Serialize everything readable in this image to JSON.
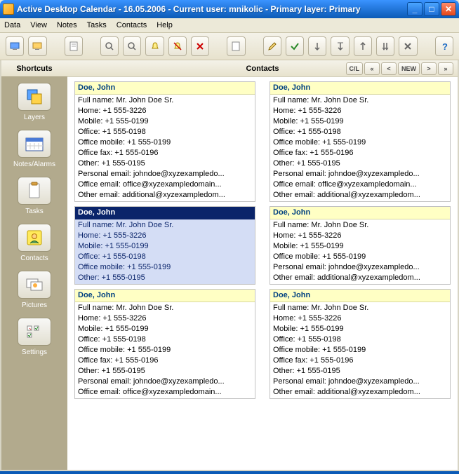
{
  "window": {
    "title": "Active Desktop Calendar - 16.05.2006 - Current user: mnikolic - Primary layer: Primary"
  },
  "menu": {
    "items": [
      "Data",
      "View",
      "Notes",
      "Tasks",
      "Contacts",
      "Help"
    ]
  },
  "sidebar": {
    "header": "Shortcuts",
    "items": [
      {
        "id": "layers",
        "label": "Layers"
      },
      {
        "id": "notes-alarms",
        "label": "Notes/Alarms"
      },
      {
        "id": "tasks",
        "label": "Tasks"
      },
      {
        "id": "contacts",
        "label": "Contacts"
      },
      {
        "id": "pictures",
        "label": "Pictures"
      },
      {
        "id": "settings",
        "label": "Settings"
      }
    ]
  },
  "main": {
    "title": "Contacts",
    "nav": {
      "cl": "C/L",
      "prev2": "«",
      "prev": "<",
      "new": "NEW",
      "next": ">",
      "next2": "»"
    }
  },
  "contacts": [
    {
      "name": "Doe, John",
      "selected": false,
      "rows": [
        "Full name: Mr. John Doe  Sr.",
        "Home:  +1 555-3226",
        "Mobile:  +1 555-0199",
        "Office:  +1 555-0198",
        "Office mobile:  +1 555-0199",
        "Office fax:  +1 555-0196",
        "Other:  +1 555-0195",
        "Personal email: johndoe@xyzexampledo...",
        "Office email: office@xyzexampledomain...",
        "Other email: additional@xyzexampledom..."
      ]
    },
    {
      "name": "Doe, John",
      "selected": false,
      "rows": [
        "Full name: Mr. John Doe  Sr.",
        "Home:  +1 555-3226",
        "Mobile:  +1 555-0199",
        "Office:  +1 555-0198",
        "Office mobile:  +1 555-0199",
        "Office fax:  +1 555-0196",
        "Other:  +1 555-0195",
        "Personal email: johndoe@xyzexampledo...",
        "Office email: office@xyzexampledomain...",
        "Other email: additional@xyzexampledom..."
      ]
    },
    {
      "name": "Doe, John",
      "selected": true,
      "rows": [
        "Full name: Mr. John Doe  Sr.",
        "Home:  +1 555-3226",
        "Mobile:  +1 555-0199",
        "Office:  +1 555-0198",
        "Office mobile:  +1 555-0199",
        "Other:  +1 555-0195"
      ]
    },
    {
      "name": "Doe, John",
      "selected": false,
      "rows": [
        "Full name: Mr. John Doe  Sr.",
        "Home:  +1 555-3226",
        "Mobile:  +1 555-0199",
        "Office mobile:  +1 555-0199",
        "Personal email: johndoe@xyzexampledo...",
        "Other email: additional@xyzexampledom..."
      ]
    },
    {
      "name": "Doe, John",
      "selected": false,
      "rows": [
        "Full name: Mr. John Doe  Sr.",
        "Home:  +1 555-3226",
        "Mobile:  +1 555-0199",
        "Office:  +1 555-0198",
        "Office mobile:  +1 555-0199",
        "Office fax:  +1 555-0196",
        "Other:  +1 555-0195",
        "Personal email: johndoe@xyzexampledo...",
        "Office email: office@xyzexampledomain..."
      ]
    },
    {
      "name": "Doe, John",
      "selected": false,
      "rows": [
        "Full name: Mr. John Doe  Sr.",
        "Home:  +1 555-3226",
        "Mobile:  +1 555-0199",
        "Office:  +1 555-0198",
        "Office mobile:  +1 555-0199",
        "Office fax:  +1 555-0196",
        "Other:  +1 555-0195",
        "Personal email: johndoe@xyzexampledo...",
        "Other email: additional@xyzexampledom..."
      ]
    }
  ]
}
